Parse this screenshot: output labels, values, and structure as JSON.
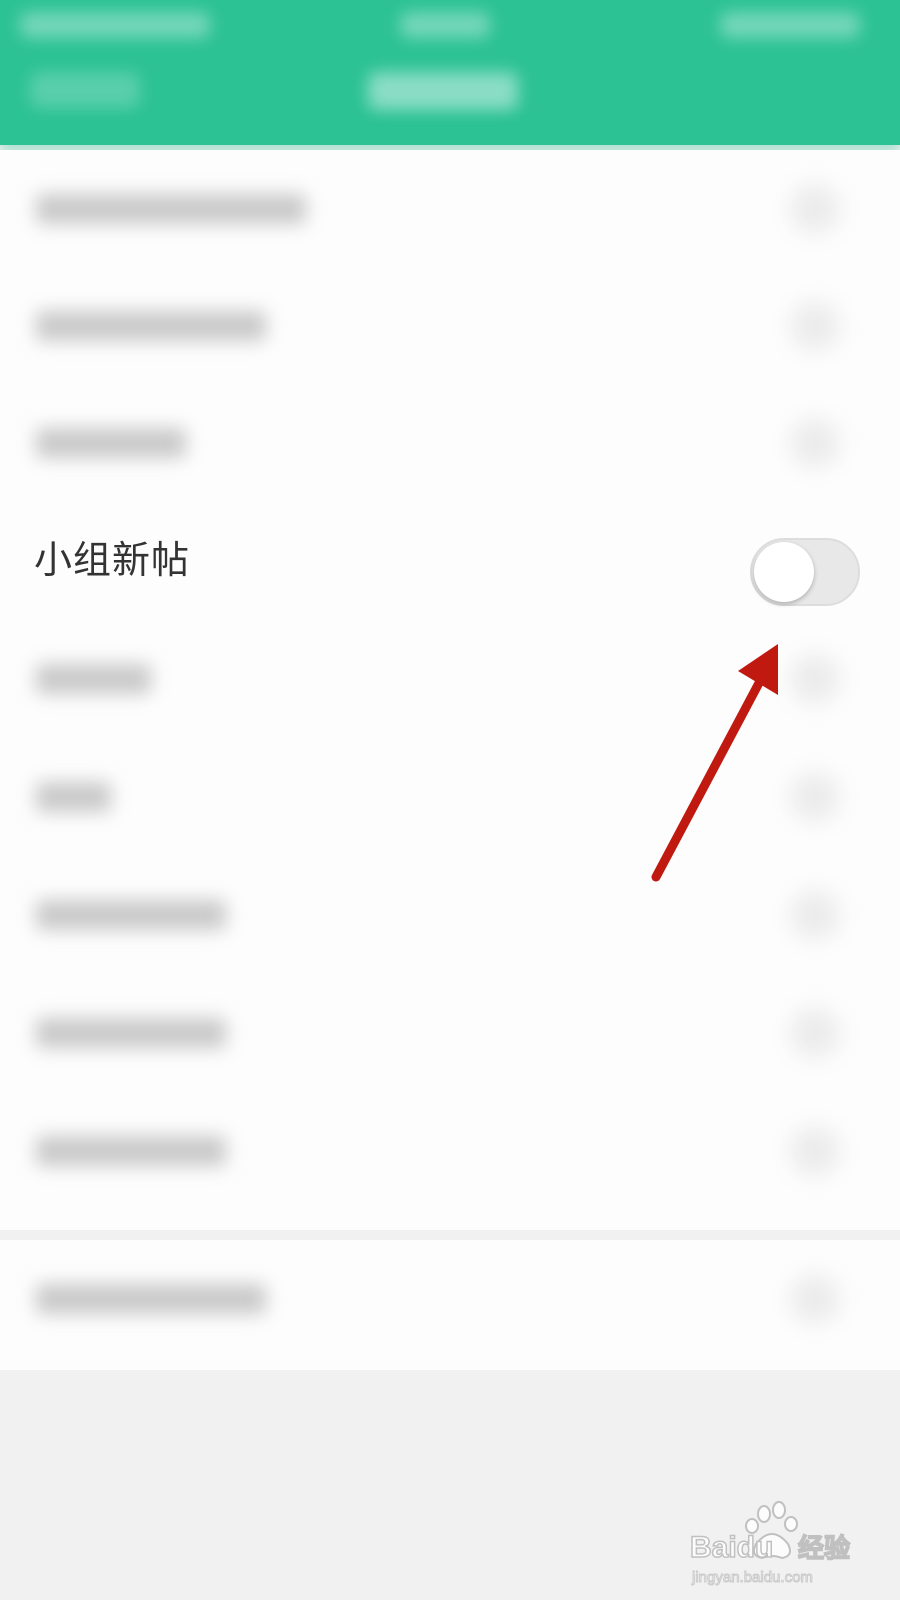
{
  "settings": {
    "highlighted_row": {
      "label": "小组新帖",
      "toggle_on": false
    }
  },
  "colors": {
    "header": "#2cc294",
    "arrow": "#c0190f",
    "toggle_track": "#e8e8e8",
    "label_text": "#333333"
  },
  "icons": {
    "annotation": "red-arrow-icon",
    "watermark": "baidu-jingyan-logo"
  },
  "watermark": {
    "brand": "Baidu",
    "cn": "经验",
    "url": "jingyan.baidu.com"
  }
}
